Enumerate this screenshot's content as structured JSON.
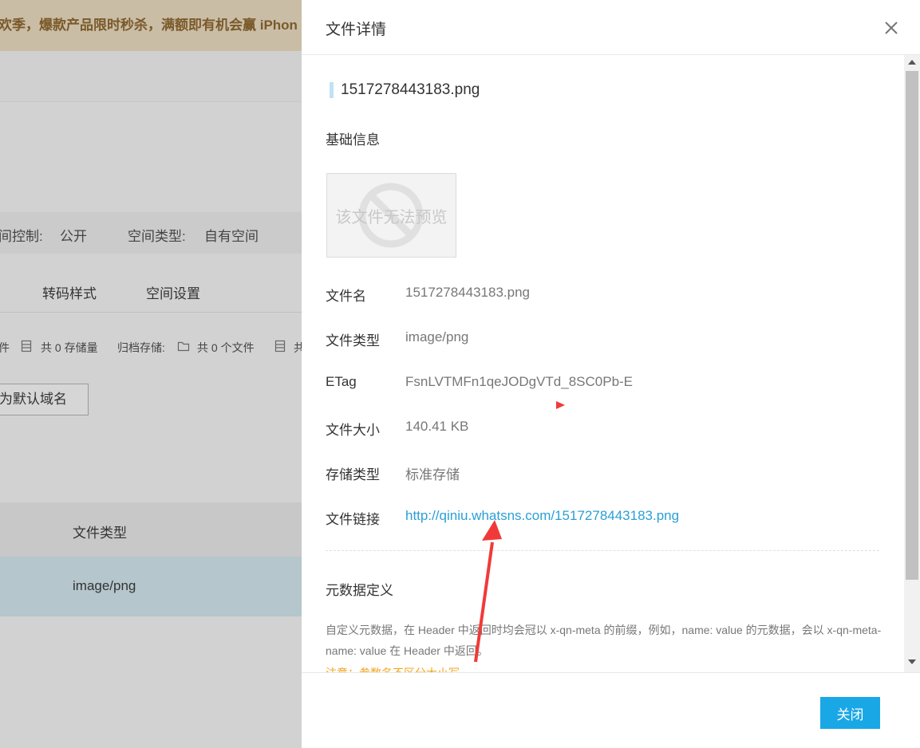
{
  "background": {
    "banner": "欢季，爆款产品限时秒杀，满额即有机会赢 iPhon",
    "info": {
      "access_label": "间控制:",
      "access_value": "公开",
      "type_label": "空间类型:",
      "type_value": "自有空间"
    },
    "tabs": [
      "转码样式",
      "空间设置"
    ],
    "stats": {
      "s1": "件",
      "s2": "共 0 存储量",
      "s3": "归档存储:",
      "s4": "共 0 个文件",
      "s5": "共"
    },
    "default_domain_button": "为默认域名",
    "table_header": "文件类型",
    "table_row_type": "image/png"
  },
  "drawer": {
    "title": "文件详情",
    "file_name_heading": "1517278443183.png",
    "basic_info_title": "基础信息",
    "preview_text": "该文件无法预览",
    "fields": [
      {
        "label": "文件名",
        "value": "1517278443183.png"
      },
      {
        "label": "文件类型",
        "value": "image/png"
      },
      {
        "label": "ETag",
        "value": "FsnLVTMFn1qeJODgVTd_8SC0Pb-E"
      },
      {
        "label": "文件大小",
        "value": "140.41 KB"
      },
      {
        "label": "存储类型",
        "value": "标准存储"
      },
      {
        "label": "文件链接",
        "value": "http://qiniu.whatsns.com/1517278443183.png"
      }
    ],
    "metadata_title": "元数据定义",
    "metadata_desc": "自定义元数据，在 Header 中返回时均会冠以 x-qn-meta 的前缀，例如，name: value 的元数据，会以 x-qn-meta-name: value 在 Header 中返回。",
    "metadata_note": "注意：参数名不区分大小写",
    "close_button": "关闭"
  },
  "colors": {
    "accent": "#1aa7e6",
    "link": "#2a9fd6",
    "note": "#f5a623",
    "annotation_arrow": "#f03a3a"
  }
}
